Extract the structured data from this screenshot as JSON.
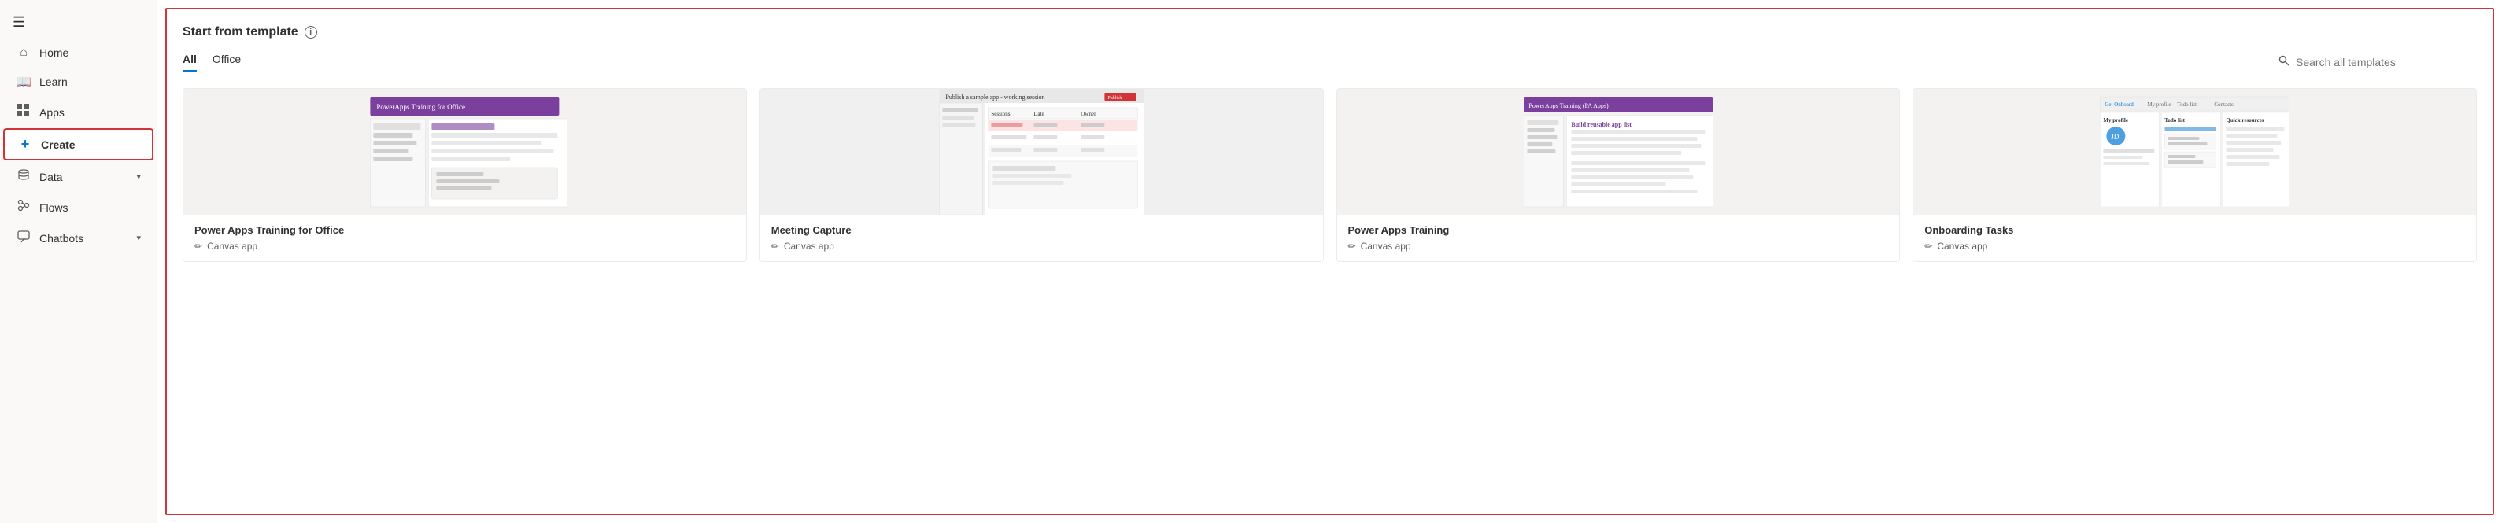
{
  "sidebar": {
    "hamburger_icon": "☰",
    "items": [
      {
        "id": "home",
        "label": "Home",
        "icon": "🏠",
        "active": false,
        "has_chevron": false
      },
      {
        "id": "learn",
        "label": "Learn",
        "icon": "📖",
        "active": false,
        "has_chevron": false
      },
      {
        "id": "apps",
        "label": "Apps",
        "icon": "⊞",
        "active": false,
        "has_chevron": false
      },
      {
        "id": "create",
        "label": "Create",
        "icon": "+",
        "active": true,
        "has_chevron": false
      },
      {
        "id": "data",
        "label": "Data",
        "icon": "🗄",
        "active": false,
        "has_chevron": true
      },
      {
        "id": "flows",
        "label": "Flows",
        "icon": "↺",
        "active": false,
        "has_chevron": false
      },
      {
        "id": "chatbots",
        "label": "Chatbots",
        "icon": "💬",
        "active": false,
        "has_chevron": true
      }
    ]
  },
  "main": {
    "section_title": "Start from template",
    "info_tooltip": "i",
    "tabs": [
      {
        "id": "all",
        "label": "All",
        "active": true
      },
      {
        "id": "office",
        "label": "Office",
        "active": false
      }
    ],
    "search_placeholder": "Search all templates",
    "cards": [
      {
        "id": "card-1",
        "title": "Power Apps Training for Office",
        "type": "Canvas app",
        "thumb_color": "#7b3f9e"
      },
      {
        "id": "card-2",
        "title": "Meeting Capture",
        "type": "Canvas app",
        "thumb_color": "#d13438"
      },
      {
        "id": "card-3",
        "title": "Power Apps Training",
        "type": "Canvas app",
        "thumb_color": "#7b3f9e"
      },
      {
        "id": "card-4",
        "title": "Onboarding Tasks",
        "type": "Canvas app",
        "thumb_color": "#0078d4"
      }
    ]
  }
}
